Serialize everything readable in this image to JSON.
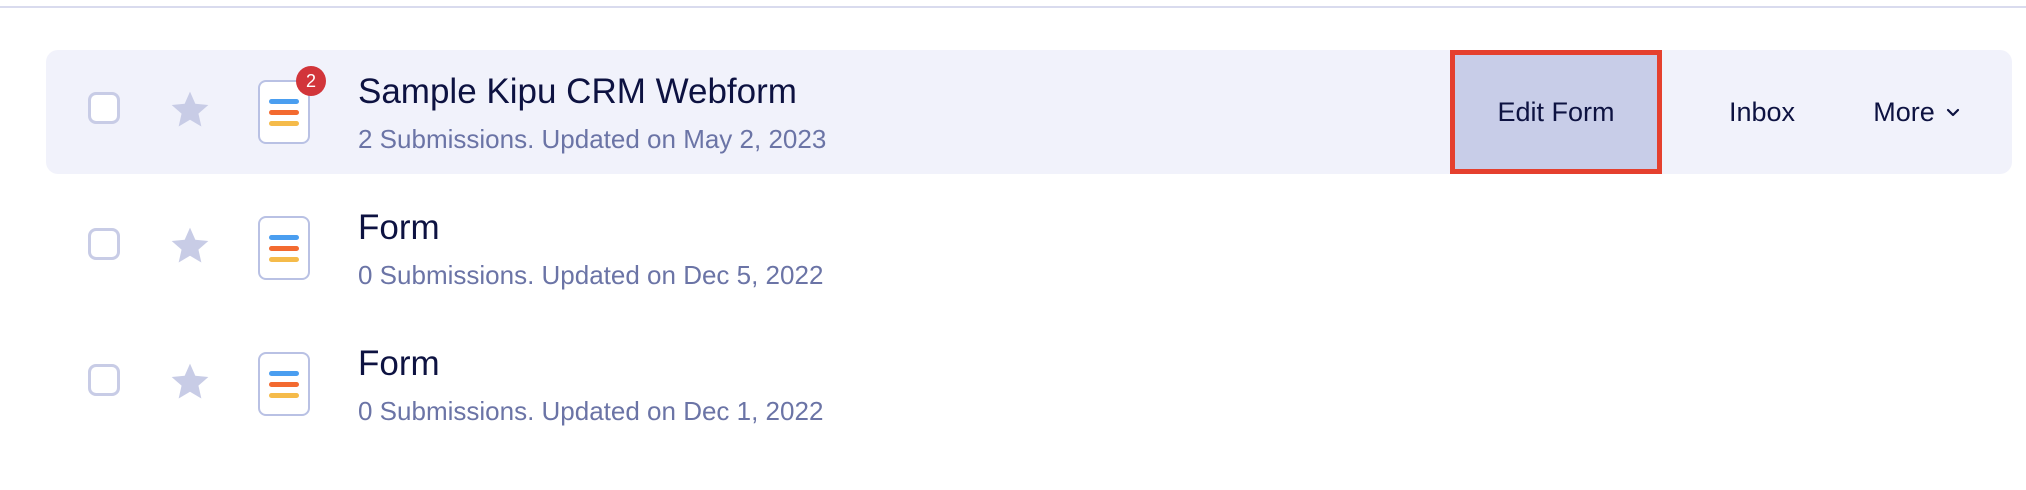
{
  "forms": [
    {
      "title": "Sample Kipu CRM Webform",
      "subtitle": "2 Submissions. Updated on May 2, 2023",
      "badge": "2"
    },
    {
      "title": "Form",
      "subtitle": "0 Submissions. Updated on Dec 5, 2022"
    },
    {
      "title": "Form",
      "subtitle": "0 Submissions. Updated on Dec 1, 2022"
    }
  ],
  "actions": {
    "edit_label": "Edit Form",
    "inbox_label": "Inbox",
    "more_label": "More"
  },
  "colors": {
    "highlight_border": "#e5402e",
    "edit_bg": "#c8cde8",
    "row_selected_bg": "#f1f2fb",
    "badge": "#d2353a"
  }
}
